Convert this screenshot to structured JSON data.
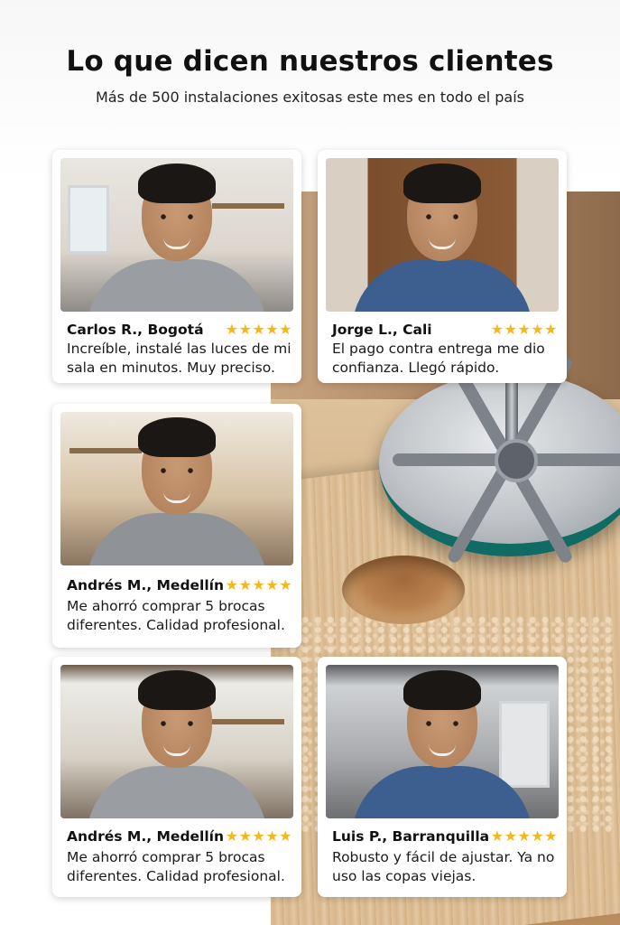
{
  "header": {
    "title": "Lo que dicen nuestros clientes",
    "subtitle": "Más de 500 instalaciones exitosas este mes en todo el país"
  },
  "colors": {
    "star": "#f4b81c",
    "tool_base": "#0f6b64"
  },
  "testimonials": [
    {
      "name": "Carlos R., Bogotá",
      "stars": "★★★★★",
      "rating": 5,
      "quote": "Increíble, instalé las luces de mi sala en minutos. Muy preciso.",
      "photo_scene": "living-room",
      "shirt_color": "#9a9ea2"
    },
    {
      "name": "Jorge L., Cali",
      "stars": "★★★★★",
      "rating": 5,
      "quote": "El pago contra entrega me dio confianza. Llegó rápido.",
      "photo_scene": "front-door",
      "shirt_color": "#3d5f8f"
    },
    {
      "name": "Andrés M., Medellín",
      "stars": "★★★★★",
      "rating": 5,
      "quote": "Me ahorró comprar 5 brocas diferentes. Calidad profesional.",
      "photo_scene": "workshop",
      "shirt_color": "#8f9397"
    },
    {
      "name": "Andrés M., Medellín",
      "stars": "★★★★★",
      "rating": 5,
      "quote": "Me ahorró comprar 5 brocas diferentes. Calidad profesional.",
      "photo_scene": "workshop",
      "shirt_color": "#9a9ea2"
    },
    {
      "name": "Luis P., Barranquilla",
      "stars": "★★★★★",
      "rating": 5,
      "quote": "Robusto y fácil de ajustar. Ya no uso las copas viejas.",
      "photo_scene": "garage",
      "shirt_color": "#3d5f8f"
    }
  ]
}
